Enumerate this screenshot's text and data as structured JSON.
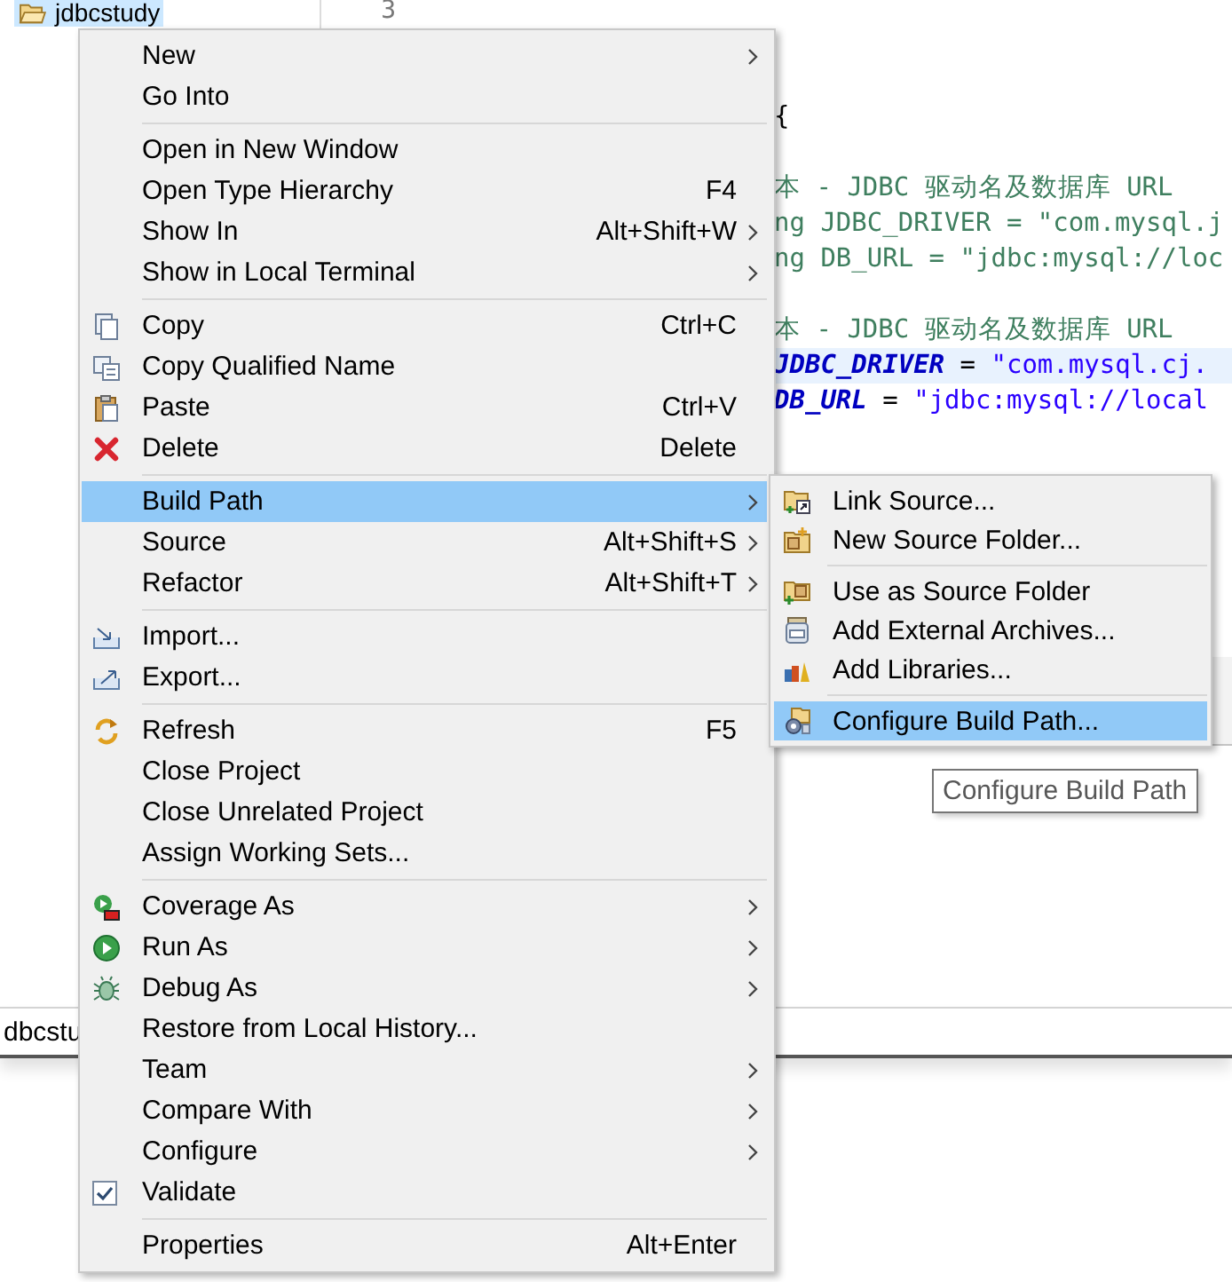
{
  "project_tree": {
    "items": [
      {
        "label": "jdbcstudy",
        "selected": true
      }
    ]
  },
  "editor": {
    "line_numbers": [
      "3"
    ],
    "lines": [
      {
        "current": false,
        "segments": [
          {
            "text": "{",
            "kind": "plain"
          }
        ]
      },
      {
        "current": false
      },
      {
        "current": false,
        "segments": [
          {
            "text": "本 - JDBC 驱动名及数据库 URL",
            "kind": "comment"
          }
        ]
      },
      {
        "current": false,
        "segments": [
          {
            "text": "ng JDBC_DRIVER = \"com.mysql.j",
            "kind": "comment"
          }
        ]
      },
      {
        "current": false,
        "segments": [
          {
            "text": "ng DB_URL = \"jdbc:mysql://loc",
            "kind": "comment"
          }
        ]
      },
      {
        "current": false
      },
      {
        "current": false,
        "segments": [
          {
            "text": "本 - JDBC 驱动名及数据库 URL",
            "kind": "comment"
          }
        ]
      },
      {
        "current": true,
        "segments": [
          {
            "text": "JDBC_DRIVER",
            "kind": "field"
          },
          {
            "text": " = ",
            "kind": "plain"
          },
          {
            "text": "\"com.mysql.cj.",
            "kind": "string"
          }
        ]
      },
      {
        "current": false,
        "segments": [
          {
            "text": "DB_URL",
            "kind": "field"
          },
          {
            "text": " = ",
            "kind": "plain"
          },
          {
            "text": "\"jdbc:mysql://local",
            "kind": "string"
          }
        ]
      }
    ]
  },
  "status_bar": {
    "text": "dbcstu"
  },
  "context_menu": {
    "items": [
      {
        "kind": "item",
        "label": "New",
        "submenu": true,
        "selected": false
      },
      {
        "kind": "item",
        "label": "Go Into",
        "submenu": false,
        "selected": false
      },
      {
        "kind": "separator"
      },
      {
        "kind": "item",
        "label": "Open in New Window",
        "submenu": false,
        "selected": false
      },
      {
        "kind": "item",
        "label": "Open Type Hierarchy",
        "shortcut": "F4",
        "submenu": false,
        "selected": false
      },
      {
        "kind": "item",
        "label": "Show In",
        "shortcut": "Alt+Shift+W",
        "submenu": true,
        "selected": false
      },
      {
        "kind": "item",
        "label": "Show in Local Terminal",
        "submenu": true,
        "selected": false
      },
      {
        "kind": "separator"
      },
      {
        "kind": "copy",
        "label": "Copy",
        "shortcut": "Ctrl+C",
        "submenu": false,
        "selected": false
      },
      {
        "kind": "copyname",
        "label": "Copy Qualified Name",
        "submenu": false,
        "selected": false
      },
      {
        "kind": "paste",
        "label": "Paste",
        "shortcut": "Ctrl+V",
        "submenu": false,
        "selected": false
      },
      {
        "kind": "delete",
        "label": "Delete",
        "shortcut": "Delete",
        "submenu": false,
        "selected": false
      },
      {
        "kind": "separator"
      },
      {
        "kind": "item",
        "label": "Build Path",
        "submenu": true,
        "selected": true
      },
      {
        "kind": "item",
        "label": "Source",
        "shortcut": "Alt+Shift+S",
        "submenu": true,
        "selected": false
      },
      {
        "kind": "item",
        "label": "Refactor",
        "shortcut": "Alt+Shift+T",
        "submenu": true,
        "selected": false
      },
      {
        "kind": "separator"
      },
      {
        "kind": "import",
        "label": "Import...",
        "submenu": false,
        "selected": false
      },
      {
        "kind": "export",
        "label": "Export...",
        "submenu": false,
        "selected": false
      },
      {
        "kind": "separator"
      },
      {
        "kind": "refresh",
        "label": "Refresh",
        "shortcut": "F5",
        "submenu": false,
        "selected": false
      },
      {
        "kind": "item",
        "label": "Close Project",
        "submenu": false,
        "selected": false
      },
      {
        "kind": "item",
        "label": "Close Unrelated Project",
        "submenu": false,
        "selected": false
      },
      {
        "kind": "item",
        "label": "Assign Working Sets...",
        "submenu": false,
        "selected": false
      },
      {
        "kind": "separator"
      },
      {
        "kind": "coverage",
        "label": "Coverage As",
        "submenu": true,
        "selected": false
      },
      {
        "kind": "run",
        "label": "Run As",
        "submenu": true,
        "selected": false
      },
      {
        "kind": "debug",
        "label": "Debug As",
        "submenu": true,
        "selected": false
      },
      {
        "kind": "item",
        "label": "Restore from Local History...",
        "submenu": false,
        "selected": false
      },
      {
        "kind": "item",
        "label": "Team",
        "submenu": true,
        "selected": false
      },
      {
        "kind": "item",
        "label": "Compare With",
        "submenu": true,
        "selected": false
      },
      {
        "kind": "item",
        "label": "Configure",
        "submenu": true,
        "selected": false
      },
      {
        "kind": "check",
        "label": "Validate",
        "checked": true,
        "submenu": false,
        "selected": false
      },
      {
        "kind": "separator"
      },
      {
        "kind": "item",
        "label": "Properties",
        "shortcut": "Alt+Enter",
        "submenu": false,
        "selected": false
      }
    ]
  },
  "submenu": {
    "items": [
      {
        "kind": "linksource",
        "label": "Link Source...",
        "selected": false
      },
      {
        "kind": "newfolder",
        "label": "New Source Folder...",
        "selected": false
      },
      {
        "kind": "separator"
      },
      {
        "kind": "usefolder",
        "label": "Use as Source Folder",
        "selected": false
      },
      {
        "kind": "jar",
        "label": "Add External Archives...",
        "selected": false
      },
      {
        "kind": "libraries",
        "label": "Add Libraries...",
        "selected": false
      },
      {
        "kind": "separator"
      },
      {
        "kind": "configure",
        "label": "Configure Build Path...",
        "selected": true
      }
    ]
  },
  "tooltip": {
    "text": "Configure Build Path"
  }
}
